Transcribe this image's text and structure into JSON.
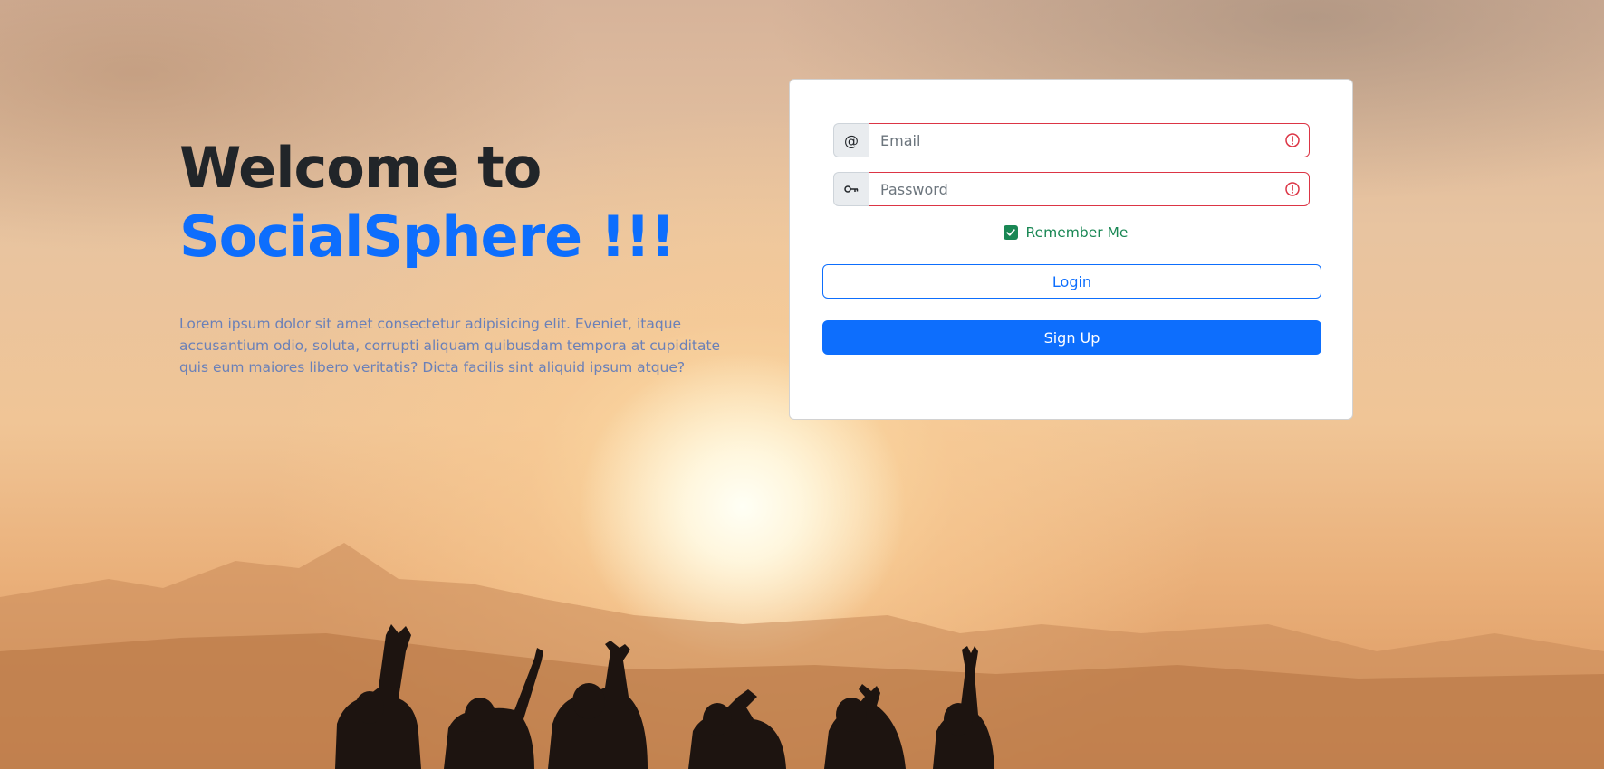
{
  "hero": {
    "title_line1": "Welcome to",
    "title_line2": "SocialSphere !!!",
    "description": "Lorem ipsum dolor sit amet consectetur adipisicing elit. Eveniet, itaque accusantium odio, soluta, corrupti aliquam quibusdam tempora at cupiditate quis eum maiores libero veritatis? Dicta facilis sint aliquid ipsum atque?"
  },
  "form": {
    "email": {
      "addon": "@",
      "placeholder": "Email",
      "value": ""
    },
    "password": {
      "addon_icon": "key-icon",
      "placeholder": "Password",
      "value": ""
    },
    "remember_me": {
      "label": "Remember Me",
      "checked": true
    },
    "login_label": "Login",
    "signup_label": "Sign Up"
  },
  "colors": {
    "primary": "#0d6efd",
    "danger": "#dc3545",
    "success": "#198754",
    "heading": "#212529"
  }
}
